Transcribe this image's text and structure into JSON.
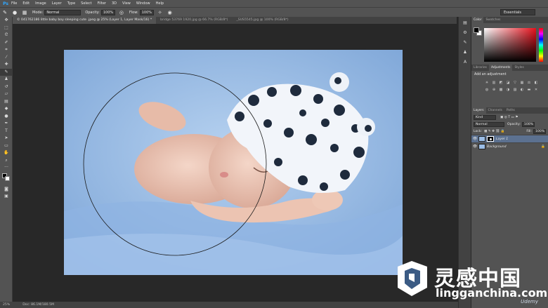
{
  "app": {
    "logo": "Ps"
  },
  "menu": [
    "File",
    "Edit",
    "Image",
    "Layer",
    "Type",
    "Select",
    "Filter",
    "3D",
    "View",
    "Window",
    "Help"
  ],
  "options": {
    "mode_label": "Mode:",
    "mode_value": "Normal",
    "opacity_label": "Opacity:",
    "opacity_value": "100%",
    "flow_label": "Flow:",
    "flow_value": "100%",
    "workspace": "Essentials"
  },
  "tabs": [
    {
      "label": "© 041762186 little baby boy sleeping cute .jpeg @ 25% (Layer 1, Layer Mask/16) *",
      "active": true
    },
    {
      "label": "bridge 53769 1920.jpg @ 66.7% (RGB/8*)",
      "active": false
    },
    {
      "label": "_SUS5545.jpg @ 100% (RGB/8*)",
      "active": false
    }
  ],
  "status": {
    "zoom": "25%",
    "doc": "Doc: 86.1M/180.5M"
  },
  "color_panel": {
    "tabs": [
      "Color",
      "Swatches"
    ],
    "active": "Color"
  },
  "adjust_panel": {
    "tabs": [
      "Libraries",
      "Adjustments",
      "Styles"
    ],
    "active": "Adjustments",
    "title": "Add an adjustment"
  },
  "layers_panel": {
    "tabs": [
      "Layers",
      "Channels",
      "Paths"
    ],
    "active": "Layers",
    "kind": "Kind",
    "blend": "Normal",
    "opacity_label": "Opacity:",
    "opacity_value": "100%",
    "lock_label": "Lock:",
    "fill_label": "Fill:",
    "fill_value": "100%",
    "layers": [
      {
        "name": "Layer 1",
        "selected": true
      },
      {
        "name": "Background",
        "selected": false
      }
    ]
  },
  "watermark": {
    "cn": "灵感中国",
    "url": "lingganchina.com",
    "udemy": "Udemy"
  }
}
